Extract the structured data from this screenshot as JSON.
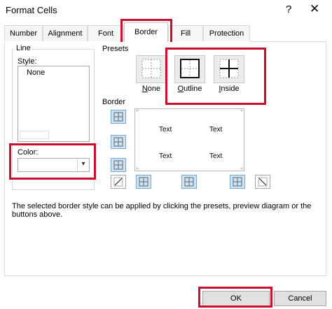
{
  "window": {
    "title": "Format Cells",
    "help": "?",
    "close": "✕"
  },
  "tabs": [
    "Number",
    "Alignment",
    "Font",
    "Border",
    "Fill",
    "Protection"
  ],
  "line": {
    "legend": "Line",
    "style_label": "Style:",
    "style_value": "None",
    "color_label": "Color:",
    "color_arrow": "▾"
  },
  "presets": {
    "legend": "Presets",
    "items": [
      {
        "label_prefix": "",
        "label_underline": "N",
        "label_rest": "one"
      },
      {
        "label_prefix": "",
        "label_underline": "O",
        "label_rest": "utline"
      },
      {
        "label_prefix": "",
        "label_underline": "I",
        "label_rest": "nside"
      }
    ]
  },
  "border": {
    "legend": "Border",
    "preview_text": [
      "Text",
      "Text",
      "Text",
      "Text"
    ]
  },
  "info_text": "The selected border style can be applied by clicking the presets, preview diagram or the buttons above.",
  "footer": {
    "ok": "OK",
    "cancel": "Cancel"
  },
  "colors": {
    "highlight": "#c8102e",
    "selected": "#cce4f7"
  }
}
